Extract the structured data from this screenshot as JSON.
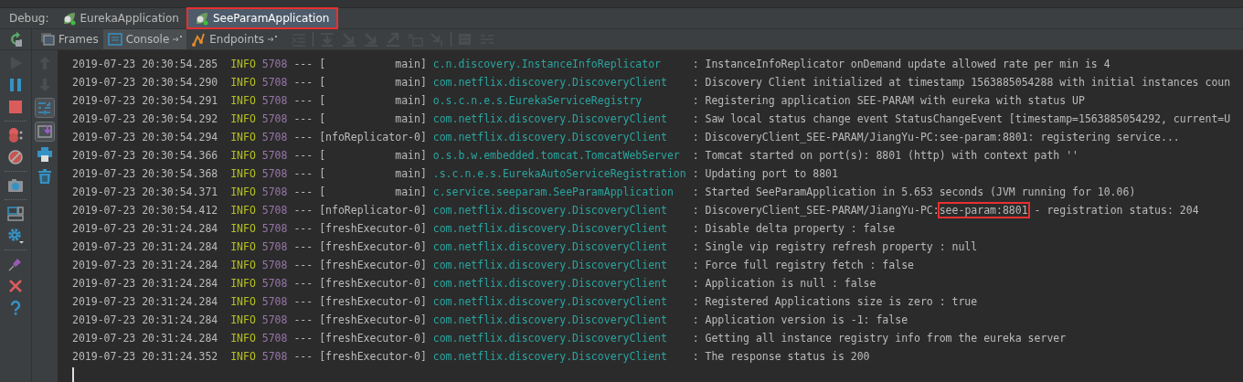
{
  "debug_bar": {
    "label": "Debug:",
    "tabs": [
      {
        "label": "EurekaApplication",
        "selected": false,
        "annotated": false
      },
      {
        "label": "SeeParamApplication",
        "selected": true,
        "annotated": true
      }
    ]
  },
  "tool_tabs": [
    {
      "label": "Frames",
      "kind": "frames",
      "selected": false
    },
    {
      "label": "Console",
      "kind": "console",
      "selected": true
    },
    {
      "label": "Endpoints",
      "kind": "endpoints",
      "selected": false
    }
  ],
  "toolbar_actions": [
    {
      "kind": "step-list",
      "disabled": true
    },
    {
      "kind": "step-over",
      "disabled": true
    },
    {
      "kind": "step-into",
      "disabled": true
    },
    {
      "kind": "force-step",
      "disabled": true
    },
    {
      "kind": "step-out",
      "disabled": true
    },
    {
      "kind": "drop-frame",
      "disabled": true
    },
    {
      "kind": "run-cursor",
      "disabled": true
    },
    {
      "kind": "evaluate",
      "disabled": true
    },
    {
      "kind": "trace",
      "disabled": true
    }
  ],
  "debug_actions": [
    {
      "kind": "rerun",
      "disabled": false
    },
    {
      "kind": "resume",
      "disabled": true
    },
    {
      "kind": "pause",
      "disabled": false
    },
    {
      "kind": "stop",
      "disabled": false
    },
    {
      "kind": "breakpoints",
      "disabled": false
    },
    {
      "kind": "mute",
      "disabled": false
    },
    {
      "kind": "camera",
      "disabled": false
    },
    {
      "kind": "layout",
      "disabled": false
    },
    {
      "kind": "settings",
      "disabled": false
    },
    {
      "kind": "pin",
      "disabled": false
    },
    {
      "kind": "close",
      "disabled": false
    },
    {
      "kind": "help",
      "disabled": false
    }
  ],
  "console_actions": [
    {
      "kind": "up",
      "selected": false,
      "disabled": true
    },
    {
      "kind": "down",
      "selected": false,
      "disabled": true
    },
    {
      "kind": "soft-wrap",
      "selected": true,
      "disabled": false
    },
    {
      "kind": "scroll-end",
      "selected": true,
      "disabled": false
    },
    {
      "kind": "print",
      "selected": false,
      "disabled": false
    },
    {
      "kind": "clear",
      "selected": false,
      "disabled": false
    }
  ],
  "log_rows": [
    {
      "time": "2019-07-23 20:30:54.285",
      "level": "INFO",
      "pid": "5708",
      "separator": "---",
      "thread": "[           main]",
      "logger": "c.n.discovery.InstanceInfoReplicator",
      "message": [
        {
          "text": ": InstanceInfoReplicator onDemand update allowed rate per min is 4",
          "boxed": false
        }
      ]
    },
    {
      "time": "2019-07-23 20:30:54.290",
      "level": "INFO",
      "pid": "5708",
      "separator": "---",
      "thread": "[           main]",
      "logger": "com.netflix.discovery.DiscoveryClient",
      "message": [
        {
          "text": ": Discovery Client initialized at timestamp 1563885054288 with initial instances coun",
          "boxed": false
        }
      ]
    },
    {
      "time": "2019-07-23 20:30:54.291",
      "level": "INFO",
      "pid": "5708",
      "separator": "---",
      "thread": "[           main]",
      "logger": "o.s.c.n.e.s.EurekaServiceRegistry",
      "message": [
        {
          "text": ": Registering application SEE-PARAM with eureka with status UP",
          "boxed": false
        }
      ]
    },
    {
      "time": "2019-07-23 20:30:54.292",
      "level": "INFO",
      "pid": "5708",
      "separator": "---",
      "thread": "[           main]",
      "logger": "com.netflix.discovery.DiscoveryClient",
      "message": [
        {
          "text": ": Saw local status change event StatusChangeEvent [timestamp=1563885054292, current=U",
          "boxed": false
        }
      ]
    },
    {
      "time": "2019-07-23 20:30:54.294",
      "level": "INFO",
      "pid": "5708",
      "separator": "---",
      "thread": "[nfoReplicator-0]",
      "logger": "com.netflix.discovery.DiscoveryClient",
      "message": [
        {
          "text": ": DiscoveryClient_SEE-PARAM/JiangYu-PC:see-param:8801: registering service...",
          "boxed": false
        }
      ]
    },
    {
      "time": "2019-07-23 20:30:54.366",
      "level": "INFO",
      "pid": "5708",
      "separator": "---",
      "thread": "[           main]",
      "logger": "o.s.b.w.embedded.tomcat.TomcatWebServer",
      "message": [
        {
          "text": ": Tomcat started on port(s): 8801 (http) with context path ''",
          "boxed": false
        }
      ]
    },
    {
      "time": "2019-07-23 20:30:54.368",
      "level": "INFO",
      "pid": "5708",
      "separator": "---",
      "thread": "[           main]",
      "logger": ".s.c.n.e.s.EurekaAutoServiceRegistration",
      "message": [
        {
          "text": ": Updating port to 8801",
          "boxed": false
        }
      ]
    },
    {
      "time": "2019-07-23 20:30:54.371",
      "level": "INFO",
      "pid": "5708",
      "separator": "---",
      "thread": "[           main]",
      "logger": "c.service.seeparam.SeeParamApplication",
      "message": [
        {
          "text": ": Started SeeParamApplication in 5.653 seconds (JVM running for 10.06)",
          "boxed": false
        }
      ]
    },
    {
      "time": "2019-07-23 20:30:54.412",
      "level": "INFO",
      "pid": "5708",
      "separator": "---",
      "thread": "[nfoReplicator-0]",
      "logger": "com.netflix.discovery.DiscoveryClient",
      "message": [
        {
          "text": ": DiscoveryClient_SEE-PARAM/JiangYu-PC:",
          "boxed": false
        },
        {
          "text": "see-param:8801",
          "boxed": true
        },
        {
          "text": " - registration status: 204",
          "boxed": false
        }
      ]
    },
    {
      "time": "2019-07-23 20:31:24.284",
      "level": "INFO",
      "pid": "5708",
      "separator": "---",
      "thread": "[freshExecutor-0]",
      "logger": "com.netflix.discovery.DiscoveryClient",
      "message": [
        {
          "text": ": Disable delta property : false",
          "boxed": false
        }
      ]
    },
    {
      "time": "2019-07-23 20:31:24.284",
      "level": "INFO",
      "pid": "5708",
      "separator": "---",
      "thread": "[freshExecutor-0]",
      "logger": "com.netflix.discovery.DiscoveryClient",
      "message": [
        {
          "text": ": Single vip registry refresh property : null",
          "boxed": false
        }
      ]
    },
    {
      "time": "2019-07-23 20:31:24.284",
      "level": "INFO",
      "pid": "5708",
      "separator": "---",
      "thread": "[freshExecutor-0]",
      "logger": "com.netflix.discovery.DiscoveryClient",
      "message": [
        {
          "text": ": Force full registry fetch : false",
          "boxed": false
        }
      ]
    },
    {
      "time": "2019-07-23 20:31:24.284",
      "level": "INFO",
      "pid": "5708",
      "separator": "---",
      "thread": "[freshExecutor-0]",
      "logger": "com.netflix.discovery.DiscoveryClient",
      "message": [
        {
          "text": ": Application is null : false",
          "boxed": false
        }
      ]
    },
    {
      "time": "2019-07-23 20:31:24.284",
      "level": "INFO",
      "pid": "5708",
      "separator": "---",
      "thread": "[freshExecutor-0]",
      "logger": "com.netflix.discovery.DiscoveryClient",
      "message": [
        {
          "text": ": Registered Applications size is zero : true",
          "boxed": false
        }
      ]
    },
    {
      "time": "2019-07-23 20:31:24.284",
      "level": "INFO",
      "pid": "5708",
      "separator": "---",
      "thread": "[freshExecutor-0]",
      "logger": "com.netflix.discovery.DiscoveryClient",
      "message": [
        {
          "text": ": Application version is -1: false",
          "boxed": false
        }
      ]
    },
    {
      "time": "2019-07-23 20:31:24.284",
      "level": "INFO",
      "pid": "5708",
      "separator": "---",
      "thread": "[freshExecutor-0]",
      "logger": "com.netflix.discovery.DiscoveryClient",
      "message": [
        {
          "text": ": Getting all instance registry info from the eureka server",
          "boxed": false
        }
      ]
    },
    {
      "time": "2019-07-23 20:31:24.352",
      "level": "INFO",
      "pid": "5708",
      "separator": "---",
      "thread": "[freshExecutor-0]",
      "logger": "com.netflix.discovery.DiscoveryClient",
      "message": [
        {
          "text": ": The response status is 200",
          "boxed": false
        }
      ]
    }
  ]
}
